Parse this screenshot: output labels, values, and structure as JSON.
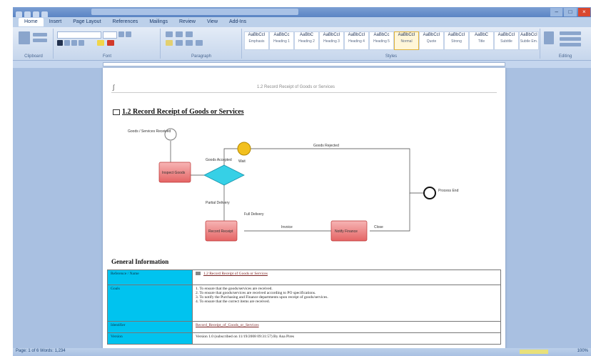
{
  "app": {
    "title_bar": "",
    "window_controls": [
      "–",
      "□",
      "×"
    ]
  },
  "ribbon": {
    "tabs": [
      "Home",
      "Insert",
      "Page Layout",
      "References",
      "Mailings",
      "Review",
      "View",
      "Add-Ins"
    ],
    "active_tab": "Home",
    "groups": [
      "Clipboard",
      "Font",
      "Paragraph",
      "Styles",
      "Editing"
    ],
    "styles": [
      {
        "preview": "AaBbCcI",
        "name": "Emphasis"
      },
      {
        "preview": "AaBbCc",
        "name": "Heading 1"
      },
      {
        "preview": "AaBbC",
        "name": "Heading 2"
      },
      {
        "preview": "AaBbCcI",
        "name": "Heading 3"
      },
      {
        "preview": "AaBbCcI",
        "name": "Heading 4"
      },
      {
        "preview": "AaBbCc",
        "name": "Heading 5"
      },
      {
        "preview": "AaBbCcI",
        "name": "Normal"
      },
      {
        "preview": "AaBbCcI",
        "name": "Quote"
      },
      {
        "preview": "AaBbCcI",
        "name": "Strong"
      },
      {
        "preview": "AaBbC",
        "name": "Title"
      },
      {
        "preview": "AaBbCcI",
        "name": "Subtitle"
      },
      {
        "preview": "AaBbCcI",
        "name": "Subtle Em."
      }
    ],
    "accent_color": "#e1b33b"
  },
  "document": {
    "section_title": "1.2 Record Receipt of Goods or Services",
    "general_information_title": "General Information",
    "table": [
      {
        "key": "Reference / Name",
        "value": "1.2 Record Receipt of Goods or Services"
      },
      {
        "key": "Goals",
        "value_lines": [
          "1. To ensure that the goods/services are received.",
          "2. To ensure that goods/services are received according to PO specifications.",
          "3. To notify the Purchasing and Finance departments upon receipt of goods/services.",
          "4. To ensure that the correct items are received."
        ]
      },
      {
        "key": "Identifier",
        "value": "Record_Receipt_of_Goods_or_Services"
      },
      {
        "key": "Version",
        "value": "Version 1.0 (subscribed on 11/19/2008 09:31:57)  By Ana Pires"
      }
    ],
    "table_key_color": "#00c3ef"
  },
  "diagram": {
    "start_label": "Goods / Services Received",
    "task1": "Inspect Goods",
    "task2": "Record Receipt",
    "task3": "Notify Finance",
    "event_label": "Wait",
    "end_label": "Process End",
    "edge_labels": [
      "Goods Rejected",
      "Goods Accepted",
      "Partial Delivery",
      "Full Delivery",
      "Invoice",
      "Close"
    ]
  },
  "status": {
    "left": "Page: 1 of 6   Words: 1,234",
    "right": "100%"
  }
}
